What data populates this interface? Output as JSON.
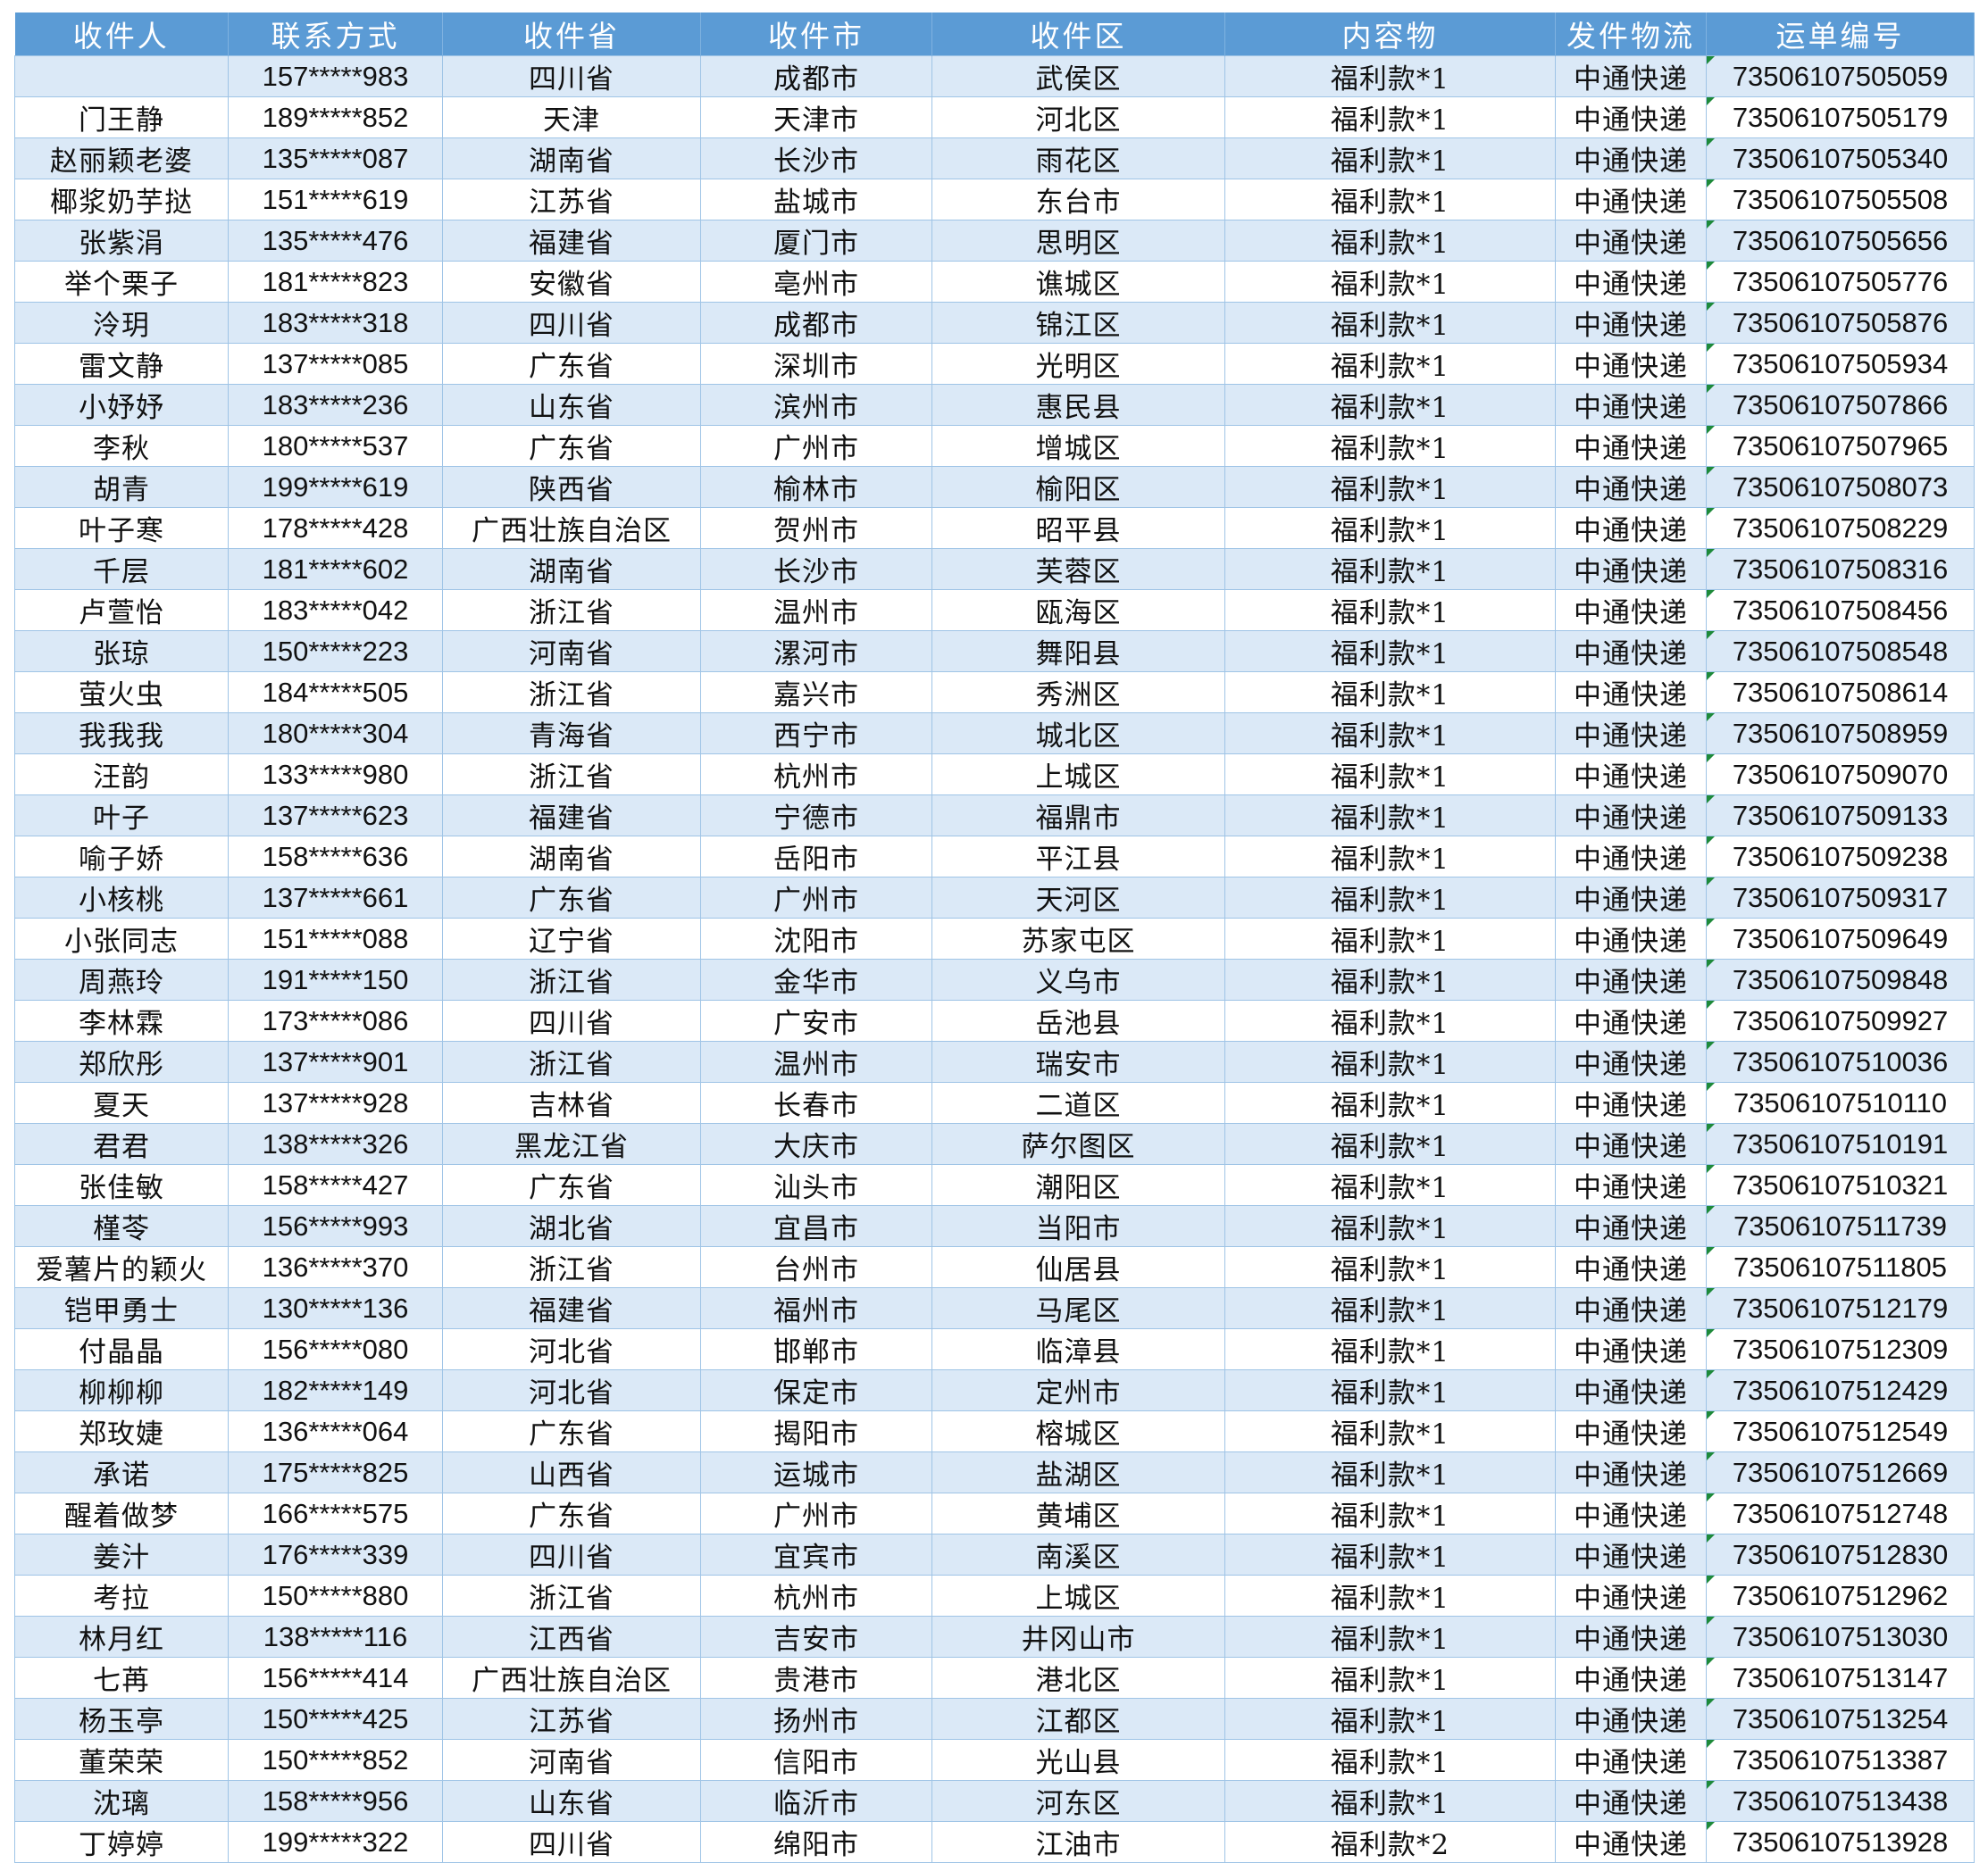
{
  "header": [
    "收件人",
    "联系方式",
    "收件省",
    "收件市",
    "收件区",
    "内容物",
    "发件物流",
    "运单编号"
  ],
  "rows": [
    [
      "",
      "157*****983",
      "四川省",
      "成都市",
      "武侯区",
      "福利款*1",
      "中通快递",
      "73506107505059"
    ],
    [
      "门王静",
      "189*****852",
      "天津",
      "天津市",
      "河北区",
      "福利款*1",
      "中通快递",
      "73506107505179"
    ],
    [
      "赵丽颖老婆",
      "135*****087",
      "湖南省",
      "长沙市",
      "雨花区",
      "福利款*1",
      "中通快递",
      "73506107505340"
    ],
    [
      "椰浆奶芋挞",
      "151*****619",
      "江苏省",
      "盐城市",
      "东台市",
      "福利款*1",
      "中通快递",
      "73506107505508"
    ],
    [
      "张紫涓",
      "135*****476",
      "福建省",
      "厦门市",
      "思明区",
      "福利款*1",
      "中通快递",
      "73506107505656"
    ],
    [
      "举个栗子",
      "181*****823",
      "安徽省",
      "亳州市",
      "谯城区",
      "福利款*1",
      "中通快递",
      "73506107505776"
    ],
    [
      "泠玥",
      "183*****318",
      "四川省",
      "成都市",
      "锦江区",
      "福利款*1",
      "中通快递",
      "73506107505876"
    ],
    [
      "雷文静",
      "137*****085",
      "广东省",
      "深圳市",
      "光明区",
      "福利款*1",
      "中通快递",
      "73506107505934"
    ],
    [
      "小妤妤",
      "183*****236",
      "山东省",
      "滨州市",
      "惠民县",
      "福利款*1",
      "中通快递",
      "73506107507866"
    ],
    [
      "李秋",
      "180*****537",
      "广东省",
      "广州市",
      "增城区",
      "福利款*1",
      "中通快递",
      "73506107507965"
    ],
    [
      "胡青",
      "199*****619",
      "陕西省",
      "榆林市",
      "榆阳区",
      "福利款*1",
      "中通快递",
      "73506107508073"
    ],
    [
      "叶子寒",
      "178*****428",
      "广西壮族自治区",
      "贺州市",
      "昭平县",
      "福利款*1",
      "中通快递",
      "73506107508229"
    ],
    [
      "千层",
      "181*****602",
      "湖南省",
      "长沙市",
      "芙蓉区",
      "福利款*1",
      "中通快递",
      "73506107508316"
    ],
    [
      "卢萱怡",
      "183*****042",
      "浙江省",
      "温州市",
      "瓯海区",
      "福利款*1",
      "中通快递",
      "73506107508456"
    ],
    [
      "张琼",
      "150*****223",
      "河南省",
      "漯河市",
      "舞阳县",
      "福利款*1",
      "中通快递",
      "73506107508548"
    ],
    [
      "萤火虫",
      "184*****505",
      "浙江省",
      "嘉兴市",
      "秀洲区",
      "福利款*1",
      "中通快递",
      "73506107508614"
    ],
    [
      "我我我",
      "180*****304",
      "青海省",
      "西宁市",
      "城北区",
      "福利款*1",
      "中通快递",
      "73506107508959"
    ],
    [
      "汪韵",
      "133*****980",
      "浙江省",
      "杭州市",
      "上城区",
      "福利款*1",
      "中通快递",
      "73506107509070"
    ],
    [
      "叶子",
      "137*****623",
      "福建省",
      "宁德市",
      "福鼎市",
      "福利款*1",
      "中通快递",
      "73506107509133"
    ],
    [
      "喻子娇",
      "158*****636",
      "湖南省",
      "岳阳市",
      "平江县",
      "福利款*1",
      "中通快递",
      "73506107509238"
    ],
    [
      "小核桃",
      "137*****661",
      "广东省",
      "广州市",
      "天河区",
      "福利款*1",
      "中通快递",
      "73506107509317"
    ],
    [
      "小张同志",
      "151*****088",
      "辽宁省",
      "沈阳市",
      "苏家屯区",
      "福利款*1",
      "中通快递",
      "73506107509649"
    ],
    [
      "周燕玲",
      "191*****150",
      "浙江省",
      "金华市",
      "义乌市",
      "福利款*1",
      "中通快递",
      "73506107509848"
    ],
    [
      "李林霖",
      "173*****086",
      "四川省",
      "广安市",
      "岳池县",
      "福利款*1",
      "中通快递",
      "73506107509927"
    ],
    [
      "郑欣彤",
      "137*****901",
      "浙江省",
      "温州市",
      "瑞安市",
      "福利款*1",
      "中通快递",
      "73506107510036"
    ],
    [
      "夏天",
      "137*****928",
      "吉林省",
      "长春市",
      "二道区",
      "福利款*1",
      "中通快递",
      "73506107510110"
    ],
    [
      "君君",
      "138*****326",
      "黑龙江省",
      "大庆市",
      "萨尔图区",
      "福利款*1",
      "中通快递",
      "73506107510191"
    ],
    [
      "张佳敏",
      "158*****427",
      "广东省",
      "汕头市",
      "潮阳区",
      "福利款*1",
      "中通快递",
      "73506107510321"
    ],
    [
      "槿苓",
      "156*****993",
      "湖北省",
      "宜昌市",
      "当阳市",
      "福利款*1",
      "中通快递",
      "73506107511739"
    ],
    [
      "爱薯片的颖火",
      "136*****370",
      "浙江省",
      "台州市",
      "仙居县",
      "福利款*1",
      "中通快递",
      "73506107511805"
    ],
    [
      "铠甲勇士",
      "130*****136",
      "福建省",
      "福州市",
      "马尾区",
      "福利款*1",
      "中通快递",
      "73506107512179"
    ],
    [
      "付晶晶",
      "156*****080",
      "河北省",
      "邯郸市",
      "临漳县",
      "福利款*1",
      "中通快递",
      "73506107512309"
    ],
    [
      "柳柳柳",
      "182*****149",
      "河北省",
      "保定市",
      "定州市",
      "福利款*1",
      "中通快递",
      "73506107512429"
    ],
    [
      "郑玫婕",
      "136*****064",
      "广东省",
      "揭阳市",
      "榕城区",
      "福利款*1",
      "中通快递",
      "73506107512549"
    ],
    [
      "承诺",
      "175*****825",
      "山西省",
      "运城市",
      "盐湖区",
      "福利款*1",
      "中通快递",
      "73506107512669"
    ],
    [
      "醒着做梦",
      "166*****575",
      "广东省",
      "广州市",
      "黄埔区",
      "福利款*1",
      "中通快递",
      "73506107512748"
    ],
    [
      "姜汁",
      "176*****339",
      "四川省",
      "宜宾市",
      "南溪区",
      "福利款*1",
      "中通快递",
      "73506107512830"
    ],
    [
      "考拉",
      "150*****880",
      "浙江省",
      "杭州市",
      "上城区",
      "福利款*1",
      "中通快递",
      "73506107512962"
    ],
    [
      "林月红",
      "138*****116",
      "江西省",
      "吉安市",
      "井冈山市",
      "福利款*1",
      "中通快递",
      "73506107513030"
    ],
    [
      "七苒",
      "156*****414",
      "广西壮族自治区",
      "贵港市",
      "港北区",
      "福利款*1",
      "中通快递",
      "73506107513147"
    ],
    [
      "杨玉亭",
      "150*****425",
      "江苏省",
      "扬州市",
      "江都区",
      "福利款*1",
      "中通快递",
      "73506107513254"
    ],
    [
      "董荣荣",
      "150*****852",
      "河南省",
      "信阳市",
      "光山县",
      "福利款*1",
      "中通快递",
      "73506107513387"
    ],
    [
      "沈璃",
      "158*****956",
      "山东省",
      "临沂市",
      "河东区",
      "福利款*1",
      "中通快递",
      "73506107513438"
    ],
    [
      "丁婷婷",
      "199*****322",
      "四川省",
      "绵阳市",
      "江油市",
      "福利款*2",
      "中通快递",
      "73506107513928"
    ]
  ]
}
